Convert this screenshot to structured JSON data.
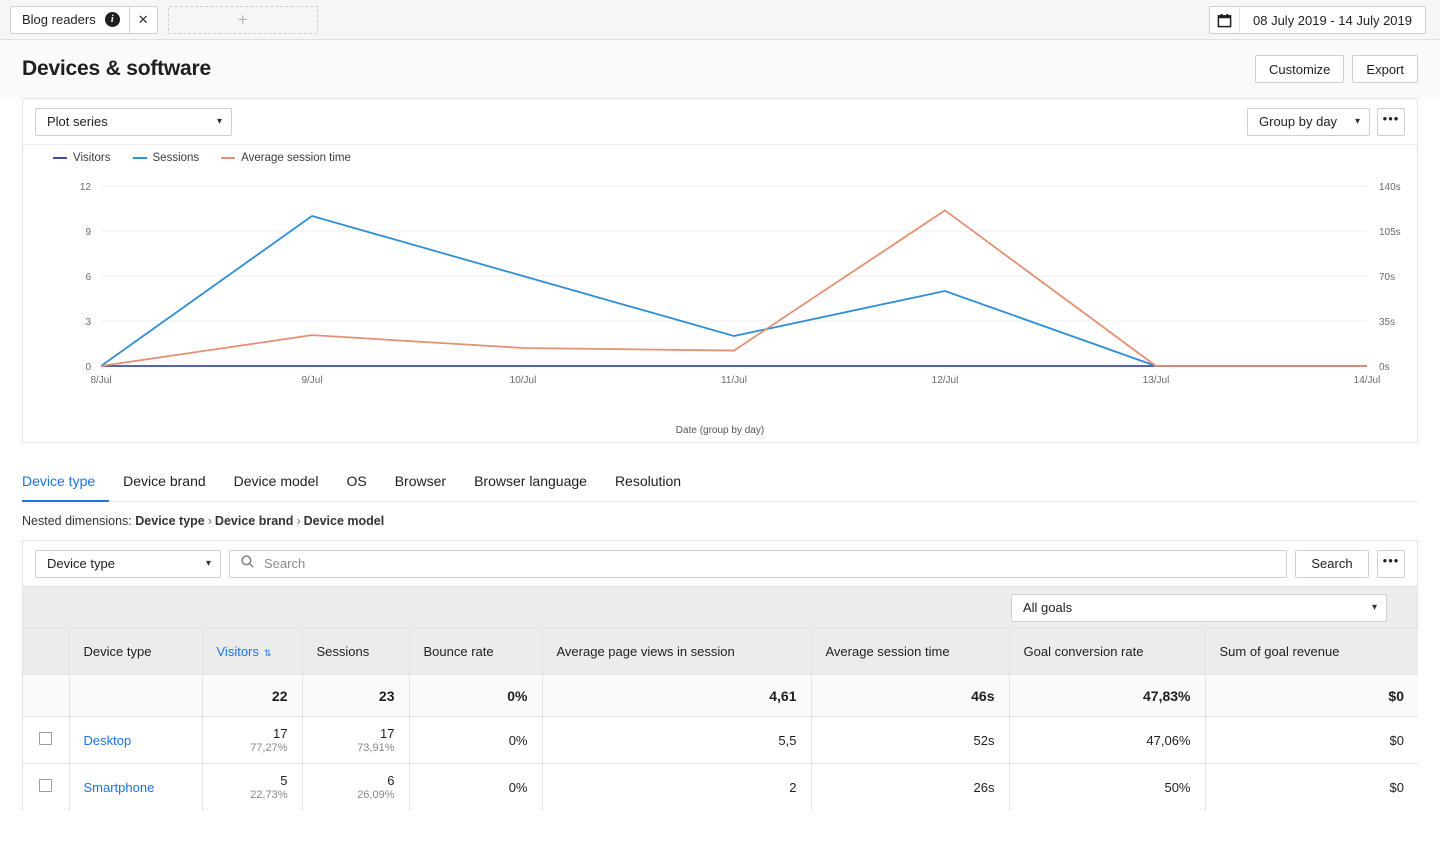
{
  "tabbar": {
    "doc_tab_label": "Blog readers",
    "info_icon": "info-icon",
    "close_icon": "✕",
    "new_tab_icon": "+",
    "date_range": "08 July 2019 - 14 July 2019"
  },
  "header": {
    "title": "Devices & software",
    "customize_label": "Customize",
    "export_label": "Export"
  },
  "chart_toolbar": {
    "plot_series_label": "Plot series",
    "group_by_label": "Group by day",
    "kebab_label": "•••"
  },
  "chart_data": {
    "type": "line",
    "title": "",
    "xlabel": "Date (group by day)",
    "ylabel": "",
    "grid": true,
    "legend_position": "top-left",
    "categories": [
      "8/Jul",
      "9/Jul",
      "10/Jul",
      "11/Jul",
      "12/Jul",
      "13/Jul",
      "14/Jul"
    ],
    "x_tick_labels": [
      "8/Jul",
      "9/Jul",
      "10/Jul",
      "11/Jul",
      "12/Jul",
      "13/Jul",
      "14/Jul"
    ],
    "y_left": {
      "ticks": [
        0,
        3,
        6,
        9,
        12
      ],
      "tick_labels": [
        "0",
        "3",
        "6",
        "9",
        "12"
      ],
      "ylim": [
        0,
        12
      ]
    },
    "y_right": {
      "ticks": [
        0,
        35,
        70,
        105,
        140
      ],
      "tick_labels": [
        "0s",
        "35s",
        "70s",
        "105s",
        "140s"
      ],
      "ylim": [
        0,
        140
      ]
    },
    "series": [
      {
        "name": "Visitors",
        "color": "#3b4ea8",
        "axis": "left",
        "values": [
          0,
          0,
          0,
          0,
          0,
          0,
          0
        ]
      },
      {
        "name": "Sessions",
        "color": "#2e8fd4",
        "axis": "left",
        "values": [
          0,
          10,
          6,
          2,
          5,
          0,
          0
        ]
      },
      {
        "name": "Average session time",
        "color": "#e58f73",
        "axis": "right",
        "values": [
          0,
          24,
          14,
          12,
          121,
          0,
          0
        ]
      }
    ]
  },
  "dimension_tabs": [
    {
      "label": "Device type",
      "active": true
    },
    {
      "label": "Device brand",
      "active": false
    },
    {
      "label": "Device model",
      "active": false
    },
    {
      "label": "OS",
      "active": false
    },
    {
      "label": "Browser",
      "active": false
    },
    {
      "label": "Browser language",
      "active": false
    },
    {
      "label": "Resolution",
      "active": false
    }
  ],
  "nested": {
    "prefix": "Nested dimensions:",
    "items": [
      "Device type",
      "Device brand",
      "Device model"
    ],
    "separator": "›"
  },
  "search_row": {
    "dimension_select": "Device type",
    "search_placeholder": "Search",
    "search_button": "Search",
    "kebab_label": "•••"
  },
  "goal_select": "All goals",
  "table": {
    "columns": [
      "Device type",
      "Visitors",
      "Sessions",
      "Bounce rate",
      "Average page views in session",
      "Average session time",
      "Goal conversion rate",
      "Sum of goal revenue"
    ],
    "sorted_column": "Visitors",
    "sort_icon": "⇅",
    "totals": {
      "visitors": "22",
      "sessions": "23",
      "bounce_rate": "0%",
      "avg_page_views": "4,61",
      "avg_session_time": "46s",
      "goal_conversion_rate": "47,83%",
      "goal_revenue": "$0"
    },
    "rows": [
      {
        "name": "Desktop",
        "visitors": "17",
        "visitors_pct": "77,27%",
        "sessions": "17",
        "sessions_pct": "73,91%",
        "bounce_rate": "0%",
        "avg_page_views": "5,5",
        "avg_session_time": "52s",
        "goal_conversion_rate": "47,06%",
        "goal_revenue": "$0"
      },
      {
        "name": "Smartphone",
        "visitors": "5",
        "visitors_pct": "22,73%",
        "sessions": "6",
        "sessions_pct": "26,09%",
        "bounce_rate": "0%",
        "avg_page_views": "2",
        "avg_session_time": "26s",
        "goal_conversion_rate": "50%",
        "goal_revenue": "$0"
      }
    ]
  },
  "colors": {
    "accent": "#1a73e8",
    "visitors": "#3b4ea8",
    "sessions": "#2e8fd4",
    "avg_session_time": "#e58f73",
    "header_bg": "#ececec"
  }
}
